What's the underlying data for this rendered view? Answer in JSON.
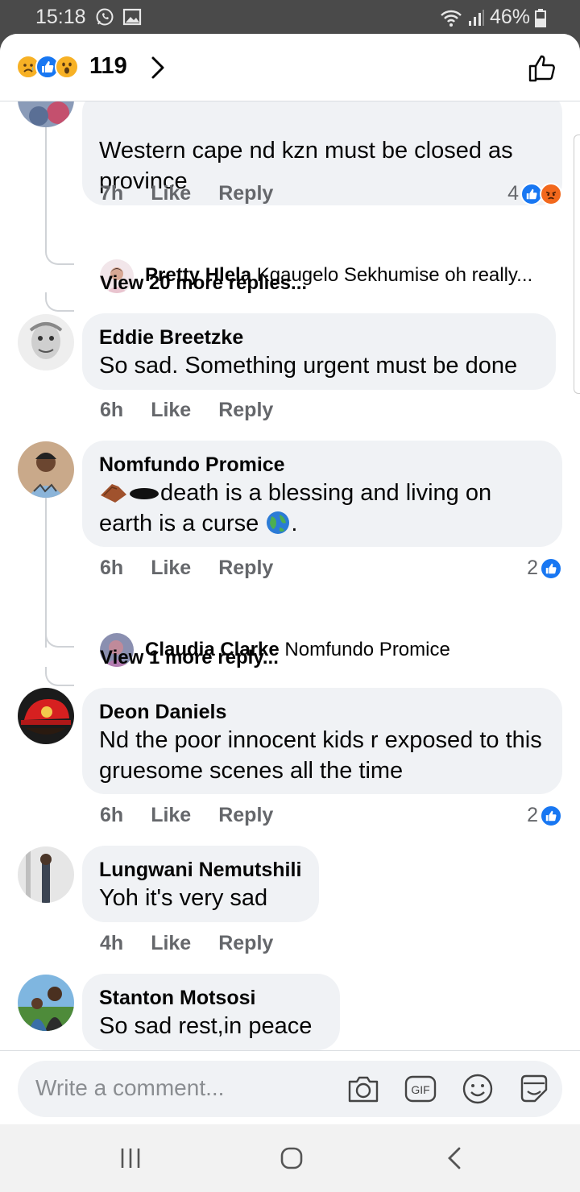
{
  "status_bar": {
    "time": "15:18",
    "battery": "46%"
  },
  "header": {
    "reaction_count": "119"
  },
  "comments": [
    {
      "text": "Western cape nd kzn must be closed as province",
      "time": "7h",
      "like": "Like",
      "reply": "Reply",
      "reaction_count": "4",
      "reply_preview": {
        "author": "Pretty Hlela",
        "text": "Kgaugelo Sekhumise oh really..."
      },
      "view_more": "View 20 more replies..."
    },
    {
      "author": "Eddie Breetzke",
      "text": "So sad. Something urgent must be done",
      "time": "6h",
      "like": "Like",
      "reply": "Reply"
    },
    {
      "author": "Nomfundo Promice",
      "text_line1": "death is a blessing and living on",
      "text_line2": "earth is a curse",
      "text_end": ".",
      "time": "6h",
      "like": "Like",
      "reply": "Reply",
      "reaction_count": "2",
      "reply_preview": {
        "author": "Claudia Clarke",
        "text": "Nomfundo Promice"
      },
      "view_more": "View 1 more reply..."
    },
    {
      "author": "Deon Daniels",
      "text": "Nd the poor innocent kids r exposed to this gruesome scenes all the time",
      "time": "6h",
      "like": "Like",
      "reply": "Reply",
      "reaction_count": "2"
    },
    {
      "author": "Lungwani Nemutshili",
      "text": "Yoh it's very sad",
      "time": "4h",
      "like": "Like",
      "reply": "Reply"
    },
    {
      "author": "Stanton Motsosi",
      "text": "So sad rest,in peace"
    }
  ],
  "composer": {
    "placeholder": "Write a comment...",
    "gif_label": "GIF"
  },
  "colors": {
    "facebook_blue": "#1877f2",
    "bubble": "#f0f2f5",
    "meta_gray": "#65676b"
  }
}
